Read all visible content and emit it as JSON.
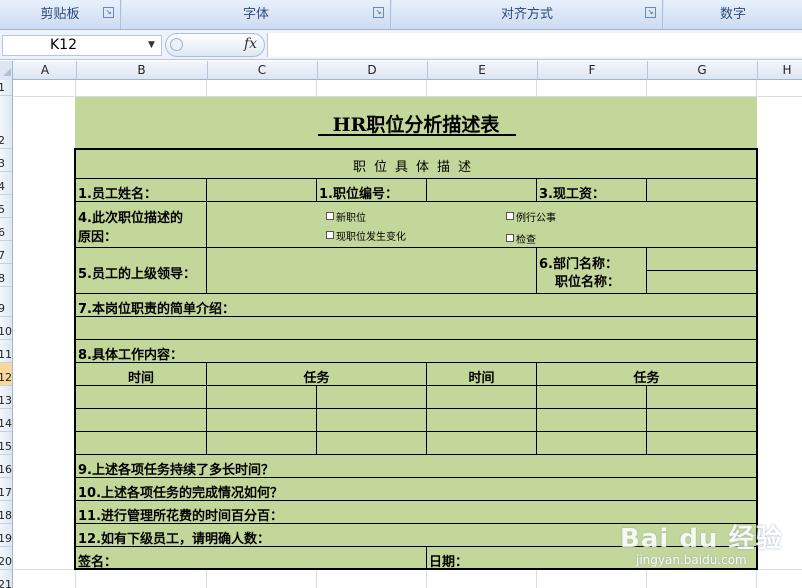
{
  "ribbon": {
    "groups": [
      "剪贴板",
      "字体",
      "对齐方式",
      "数字"
    ]
  },
  "formula_bar": {
    "name_box": "K12",
    "fx_label": "fx",
    "formula": ""
  },
  "columns": [
    "A",
    "B",
    "C",
    "D",
    "E",
    "F",
    "G",
    "H"
  ],
  "rows": [
    "1",
    "2",
    "3",
    "4",
    "5",
    "6",
    "7",
    "8",
    "9",
    "10",
    "11",
    "12",
    "13",
    "14",
    "15",
    "16",
    "17",
    "18",
    "19",
    "20",
    "21"
  ],
  "selected_row": "12",
  "form": {
    "title": "HR职位分析描述表",
    "subtitle": "职位具体描述",
    "employee_name": "1.员工姓名：",
    "position_number": "1.职位编号：",
    "current_salary": "3.现工资：",
    "reason_line1": "4.此次职位描述的",
    "reason_line2": "原因：",
    "opt_new_position": "新职位",
    "opt_changed": "现职位发生变化",
    "opt_routine": "例行公事",
    "opt_check": "检查",
    "supervisor": "5.员工的上级领导：",
    "department": "6.部门名称：",
    "position_name": "职位名称：",
    "duty_intro": "7.本岗位职责的简单介绍：",
    "work_content": "8.具体工作内容：",
    "col_time_1": "时间",
    "col_task_1": "任务",
    "col_time_2": "时间",
    "col_task_2": "任务",
    "q9": "9.上述各项任务持续了多长时间？",
    "q10": "10.上述各项任务的完成情况如何？",
    "q11": "11.进行管理所花费的时间百分百：",
    "q12": "12.如有下级员工，请明确人数：",
    "signature": "签名：",
    "date": "日期："
  },
  "watermark": {
    "brand": "Bai du 经验",
    "url": "jingyan.baidu.com"
  },
  "colors": {
    "form_fill": "#c4d79b",
    "ribbon": "#d6e3f5",
    "selected_row": "#f9d99b"
  }
}
